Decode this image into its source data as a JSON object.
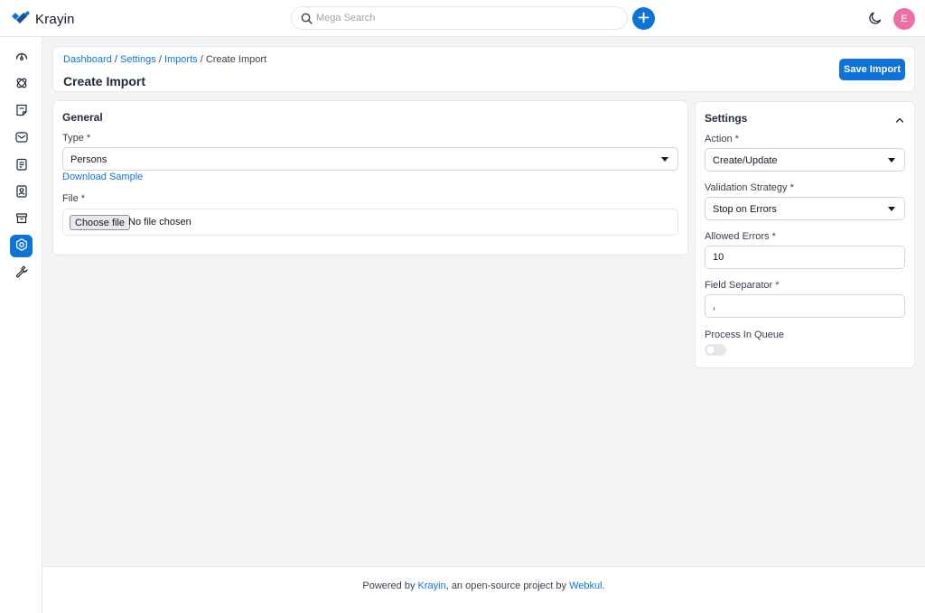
{
  "app": {
    "name": "Krayin",
    "brand_color": "#0e73d8"
  },
  "header": {
    "search": {
      "placeholder": "Mega Search",
      "value": ""
    },
    "avatar_initial": "E"
  },
  "sidebar": {
    "items": [
      {
        "name": "dashboard",
        "icon": "dashboard-icon",
        "active": false
      },
      {
        "name": "leads",
        "icon": "leads-icon",
        "active": false
      },
      {
        "name": "quotes",
        "icon": "quotes-icon",
        "active": false
      },
      {
        "name": "mail",
        "icon": "mail-icon",
        "active": false
      },
      {
        "name": "activities",
        "icon": "activities-icon",
        "active": false
      },
      {
        "name": "contacts",
        "icon": "contacts-icon",
        "active": false
      },
      {
        "name": "products",
        "icon": "products-icon",
        "active": false
      },
      {
        "name": "settings",
        "icon": "settings-icon",
        "active": true
      },
      {
        "name": "configuration",
        "icon": "wrench-icon",
        "active": false
      }
    ]
  },
  "page": {
    "breadcrumb": {
      "dashboard": "Dashboard",
      "settings": "Settings",
      "imports": "Imports",
      "current": "Create Import",
      "separator": "/"
    },
    "title": "Create Import",
    "save_label": "Save Import"
  },
  "general": {
    "title": "General",
    "type_label": "Type *",
    "type_value": "Persons",
    "download_sample": "Download Sample",
    "file_label": "File *",
    "choose_file": "Choose file",
    "file_status": "No file chosen"
  },
  "settings_panel": {
    "title": "Settings",
    "action_label": "Action *",
    "action_value": "Create/Update",
    "validation_label": "Validation Strategy *",
    "validation_value": "Stop on Errors",
    "allowed_errors_label": "Allowed Errors *",
    "allowed_errors_value": "10",
    "field_separator_label": "Field Separator *",
    "field_separator_value": ",",
    "process_in_queue_label": "Process In Queue",
    "process_in_queue_on": false
  },
  "footer": {
    "prefix": "Powered by",
    "krayin": "Krayin",
    "middle": ", an open-source project by",
    "webkul": "Webkul",
    "suffix": "."
  }
}
